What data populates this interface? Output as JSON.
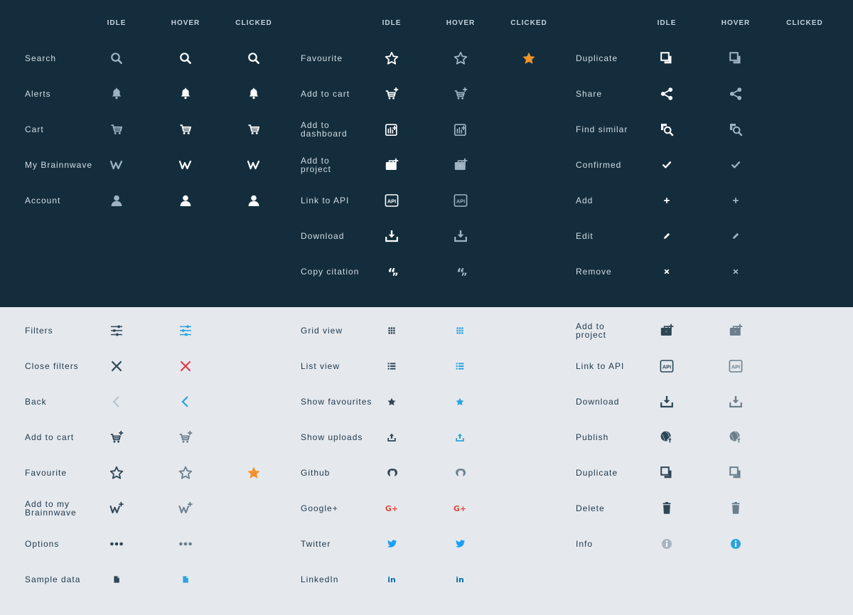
{
  "colors": {
    "dark_bg": "#132d3c",
    "light_bg": "#e5e9ee",
    "dark_idle": "#9eb3c2",
    "dark_hover": "#ffffff",
    "dark_clicked": "#ffffff",
    "dark_hover_muted": "#9eb3c2",
    "light_idle": "#2f4656",
    "light_hover_blue": "#2ba3dc",
    "light_hover_muted": "#6b7e8c",
    "close_red": "#e23c4a",
    "star_orange": "#f3922b",
    "google_red": "#dc4a3d",
    "twitter_blue": "#1da1f2",
    "linkedin_blue": "#0a6ea8",
    "info_idle": "#a8b4c0"
  },
  "headers": {
    "idle": "IDLE",
    "hover": "HOVER",
    "clicked": "CLICKED"
  },
  "dark": {
    "col1": [
      {
        "label": "Search",
        "icon": "search-icon"
      },
      {
        "label": "Alerts",
        "icon": "bell-icon"
      },
      {
        "label": "Cart",
        "icon": "cart-icon"
      },
      {
        "label": "My Brainnwave",
        "icon": "brainnwave-icon"
      },
      {
        "label": "Account",
        "icon": "user-icon"
      }
    ],
    "col2": [
      {
        "label": "Favourite",
        "icon": "star-icon"
      },
      {
        "label": "Add to cart",
        "icon": "cart-add-icon"
      },
      {
        "label": "Add to\ndashboard",
        "icon": "dashboard-add-icon"
      },
      {
        "label": "Add to\nproject",
        "icon": "briefcase-add-icon"
      },
      {
        "label": "Link to API",
        "icon": "api-icon"
      },
      {
        "label": "Download",
        "icon": "download-icon"
      },
      {
        "label": "Copy citation",
        "icon": "quote-icon"
      }
    ],
    "col3": [
      {
        "label": "Duplicate",
        "icon": "duplicate-icon"
      },
      {
        "label": "Share",
        "icon": "share-icon"
      },
      {
        "label": "Find similar",
        "icon": "find-similar-icon"
      },
      {
        "label": "Confirmed",
        "icon": "check-icon"
      },
      {
        "label": "Add",
        "icon": "plus-icon"
      },
      {
        "label": "Edit",
        "icon": "pencil-icon"
      },
      {
        "label": "Remove",
        "icon": "x-small-icon"
      }
    ]
  },
  "light": {
    "col1": [
      {
        "label": "Filters",
        "icon": "sliders-icon"
      },
      {
        "label": "Close filters",
        "icon": "close-icon"
      },
      {
        "label": "Back",
        "icon": "chevron-left-icon"
      },
      {
        "label": "Add to cart",
        "icon": "cart-add-icon"
      },
      {
        "label": "Favourite",
        "icon": "star-icon"
      },
      {
        "label": "Add to my\nBrainnwave",
        "icon": "brainnwave-add-icon"
      },
      {
        "label": "Options",
        "icon": "more-dots-icon"
      },
      {
        "label": "Sample data",
        "icon": "file-icon"
      }
    ],
    "col2": [
      {
        "label": "Grid view",
        "icon": "grid-icon"
      },
      {
        "label": "List view",
        "icon": "list-icon"
      },
      {
        "label": "Show favourites",
        "icon": "star-small-icon"
      },
      {
        "label": "Show uploads",
        "icon": "upload-icon"
      },
      {
        "label": "Github",
        "icon": "github-icon"
      },
      {
        "label": "Google+",
        "icon": "google-plus-icon",
        "text": "G+"
      },
      {
        "label": "Twitter",
        "icon": "twitter-icon"
      },
      {
        "label": "LinkedIn",
        "icon": "linkedin-icon",
        "text": "in"
      }
    ],
    "col3": [
      {
        "label": "Add to\nproject",
        "icon": "briefcase-add-icon"
      },
      {
        "label": "Link to API",
        "icon": "api-icon"
      },
      {
        "label": "Download",
        "icon": "download-icon"
      },
      {
        "label": "Publish",
        "icon": "globe-upload-icon"
      },
      {
        "label": "Duplicate",
        "icon": "duplicate-icon"
      },
      {
        "label": "Delete",
        "icon": "trash-icon"
      },
      {
        "label": "Info",
        "icon": "info-icon"
      }
    ]
  }
}
